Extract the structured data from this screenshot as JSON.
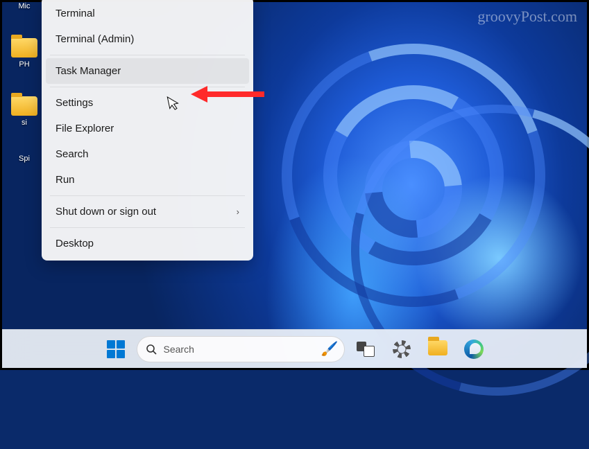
{
  "watermark": "groovyPost.com",
  "desktop": {
    "icon1_label": "Mic",
    "icon2_label": "PH",
    "icon3_label": "si",
    "icon4_label": "Spi"
  },
  "menu": {
    "items": [
      {
        "label": "Terminal",
        "type": "item"
      },
      {
        "label": "Terminal (Admin)",
        "type": "item"
      },
      {
        "type": "separator"
      },
      {
        "label": "Task Manager",
        "type": "item",
        "hover": true
      },
      {
        "type": "separator"
      },
      {
        "label": "Settings",
        "type": "item"
      },
      {
        "label": "File Explorer",
        "type": "item"
      },
      {
        "label": "Search",
        "type": "item"
      },
      {
        "label": "Run",
        "type": "item"
      },
      {
        "type": "separator"
      },
      {
        "label": "Shut down or sign out",
        "type": "submenu"
      },
      {
        "type": "separator"
      },
      {
        "label": "Desktop",
        "type": "item"
      }
    ]
  },
  "taskbar": {
    "search_placeholder": "Search"
  }
}
